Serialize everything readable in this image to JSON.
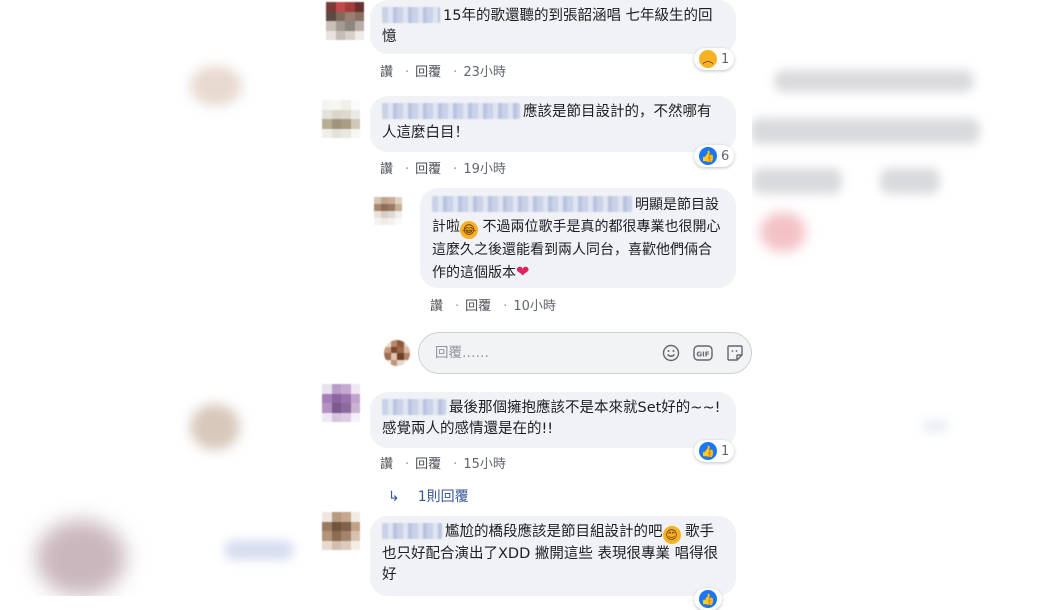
{
  "comments": [
    {
      "text": "15年的歌還聽的到張韶涵唱 七年級生的回憶",
      "actions": {
        "like": "讚",
        "reply": "回覆",
        "time": "23小時"
      },
      "reaction": {
        "icon": "sad-reaction-icon",
        "count": "1"
      }
    },
    {
      "text": "應該是節目設計的，不然哪有人這麼白目！",
      "actions": {
        "like": "讚",
        "reply": "回覆",
        "time": "19小時"
      },
      "reaction": {
        "icon": "like-reaction-icon",
        "count": "6"
      },
      "reply": {
        "text_a": "明顯是節目設計啦",
        "text_b": "不過兩位歌手是真的都很專業也很開心這麼久之後還能看到兩人同台，喜歡他們倆合作的這個版本",
        "actions": {
          "like": "讚",
          "reply": "回覆",
          "time": "10小時"
        }
      }
    },
    {
      "text": "最後那個擁抱應該不是本來就Set好的~~!感覺兩人的感情還是在的!!",
      "actions": {
        "like": "讚",
        "reply": "回覆",
        "time": "15小時"
      },
      "reaction": {
        "icon": "like-reaction-icon",
        "count": "1"
      },
      "more_replies": "1則回覆"
    },
    {
      "text_a": "尷尬的橋段應該是節目組設計的吧",
      "text_b": "歌手也只好配合演出了XDD 撇開這些 表現很專業 唱得很好"
    }
  ],
  "reply_input": {
    "placeholder": "回覆……"
  },
  "colors": {
    "bubble": "#f0f2f5",
    "like_blue": "#1877f2",
    "link": "#365899",
    "heart": "#e0245e"
  }
}
